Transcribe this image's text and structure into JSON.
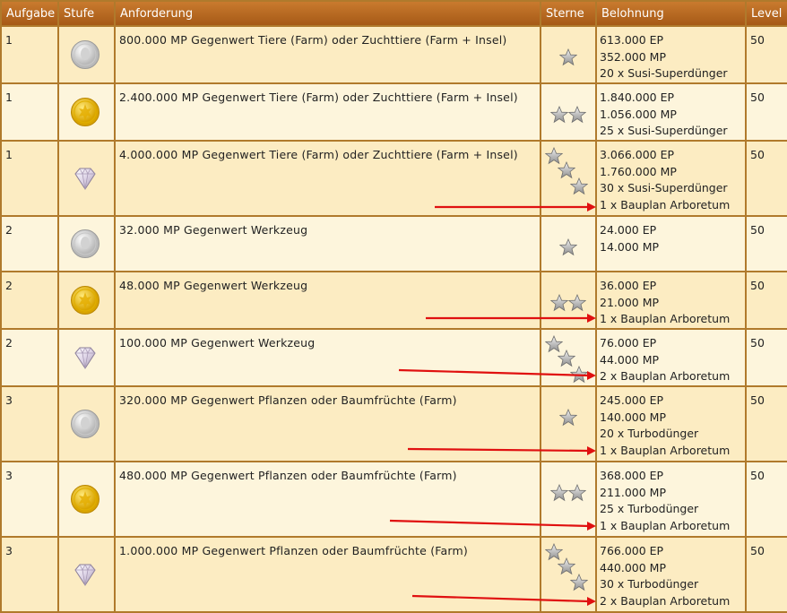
{
  "table": {
    "headers": {
      "aufgabe": "Aufgabe",
      "stufe": "Stufe",
      "anforderung": "Anforderung",
      "sterne": "Sterne",
      "belohnung": "Belohnung",
      "level": "Level"
    },
    "rows": [
      {
        "aufgabe": "1",
        "medal": "silver-coin-icon",
        "anforderung": "800.000 MP Gegenwert Tiere (Farm) oder Zuchttiere (Farm + Insel)",
        "stars": 1,
        "rewards": [
          "613.000 EP",
          "352.000 MP",
          "20 x Susi-Superdünger"
        ],
        "level": "50"
      },
      {
        "aufgabe": "1",
        "medal": "gold-coin-icon",
        "anforderung": "2.400.000 MP Gegenwert Tiere (Farm) oder Zuchttiere (Farm + Insel)",
        "stars": 2,
        "rewards": [
          "1.840.000 EP",
          "1.056.000 MP",
          "25 x Susi-Superdünger"
        ],
        "level": "50"
      },
      {
        "aufgabe": "1",
        "medal": "diamond-icon",
        "anforderung": "4.000.000 MP Gegenwert Tiere (Farm) oder Zuchttiere (Farm + Insel)",
        "stars": 3,
        "rewards": [
          "3.066.000 EP",
          "1.760.000 MP",
          "30 x Susi-Superdünger",
          "1 x Bauplan Arboretum"
        ],
        "level": "50"
      },
      {
        "aufgabe": "2",
        "medal": "silver-coin-icon",
        "anforderung": "32.000 MP Gegenwert Werkzeug",
        "stars": 1,
        "rewards": [
          "24.000 EP",
          "14.000 MP"
        ],
        "level": "50"
      },
      {
        "aufgabe": "2",
        "medal": "gold-coin-icon",
        "anforderung": "48.000 MP Gegenwert Werkzeug",
        "stars": 2,
        "rewards": [
          "36.000 EP",
          "21.000 MP",
          "1  x Bauplan Arboretum"
        ],
        "level": "50"
      },
      {
        "aufgabe": "2",
        "medal": "diamond-icon",
        "anforderung": "100.000 MP Gegenwert Werkzeug",
        "stars": 3,
        "rewards": [
          "76.000 EP",
          "44.000 MP",
          "2 x Bauplan Arboretum"
        ],
        "level": "50"
      },
      {
        "aufgabe": "3",
        "medal": "silver-coin-icon",
        "anforderung": "320.000 MP Gegenwert Pflanzen oder Baumfrüchte (Farm)",
        "stars": 1,
        "rewards": [
          "245.000 EP",
          "140.000 MP",
          "20 x Turbodünger",
          "1 x Bauplan Arboretum"
        ],
        "level": "50"
      },
      {
        "aufgabe": "3",
        "medal": "gold-coin-icon",
        "anforderung": "480.000 MP Gegenwert Pflanzen oder Baumfrüchte (Farm)",
        "stars": 2,
        "rewards": [
          "368.000 EP",
          "211.000 MP",
          "25 x Turbodünger",
          "1 x Bauplan Arboretum"
        ],
        "level": "50"
      },
      {
        "aufgabe": "3",
        "medal": "diamond-icon",
        "anforderung": "1.000.000 MP Gegenwert Pflanzen oder Baumfrüchte (Farm)",
        "stars": 3,
        "rewards": [
          "766.000 EP",
          "440.000 MP",
          "30 x Turbodünger",
          "2 x Bauplan Arboretum"
        ],
        "level": "50"
      }
    ]
  },
  "colors": {
    "header_bg": "#b8691f",
    "border": "#b07a2c",
    "row_odd": "#fcecc2",
    "row_even": "#fdf5dc",
    "arrow": "#e01010"
  }
}
